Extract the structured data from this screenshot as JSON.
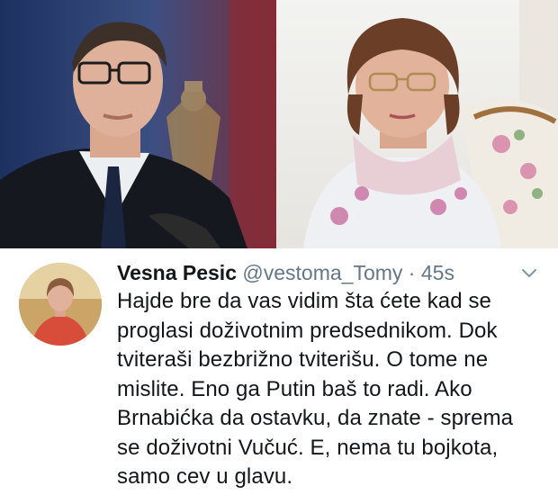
{
  "images": {
    "left_photo": "man-in-suit-photo",
    "right_photo": "woman-in-scarf-photo"
  },
  "tweet": {
    "author_name": "Vesna Pesic",
    "handle": "@vestoma_Tomy",
    "separator": "·",
    "timestamp": "45s",
    "menu_icon": "chevron-down-icon",
    "text_lines": [
      "Hajde bre da vas vidim šta ćete kad se",
      "proglasi doživotnim predsednikom. Dok",
      "tviteraši bezbrižno tviterišu. O tome ne",
      "mislite. Eno ga Putin baš to radi. Ako",
      "Brnabićka da ostavku, da znate - sprema",
      "se doživotni Vučuć. E, nema tu bojkota,",
      "samo cev u glavu."
    ]
  },
  "colors": {
    "name": "#14171a",
    "secondary": "#657786",
    "chevron": "#8899a6"
  }
}
